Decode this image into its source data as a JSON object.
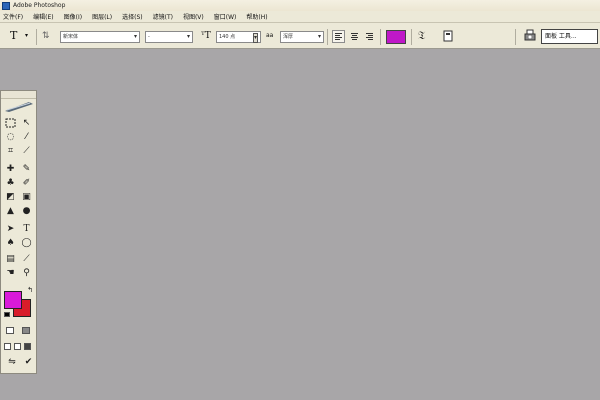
{
  "window": {
    "title": "Adobe Photoshop",
    "logo_icon": "photoshop-logo-icon"
  },
  "menu": [
    {
      "label": "文件(F)"
    },
    {
      "label": "编辑(E)"
    },
    {
      "label": "图像(I)"
    },
    {
      "label": "图层(L)"
    },
    {
      "label": "选择(S)"
    },
    {
      "label": "滤镜(T)"
    },
    {
      "label": "视图(V)"
    },
    {
      "label": "窗口(W)"
    },
    {
      "label": "帮助(H)"
    }
  ],
  "options_bar": {
    "tool_glyph": "T",
    "font_family": "新宋体",
    "font_style": "-",
    "font_size_icon": "font-size-icon",
    "font_size": "140 点",
    "anti_alias_label": "aa",
    "anti_alias": "浑厚",
    "text_color": "#c018c8",
    "palette_label": "面板 工具...",
    "icons": [
      "text-tool-icon",
      "orientation-icon",
      "align-left-icon",
      "align-center-icon",
      "align-right-icon",
      "warp-text-icon",
      "palettes-icon",
      "printer-icon"
    ]
  },
  "toolbox": {
    "tools": [
      "marquee",
      "move",
      "lasso",
      "magic-wand",
      "crop",
      "slice",
      "healing",
      "brush",
      "stamp",
      "history-brush",
      "eraser",
      "gradient",
      "blur",
      "dodge",
      "path-select",
      "type",
      "pen",
      "shape",
      "notes",
      "eyedropper",
      "hand",
      "zoom"
    ],
    "foreground_color": "#d81ad8",
    "background_color": "#d81c2a"
  },
  "canvas": {
    "background": "#a8a6a8"
  }
}
